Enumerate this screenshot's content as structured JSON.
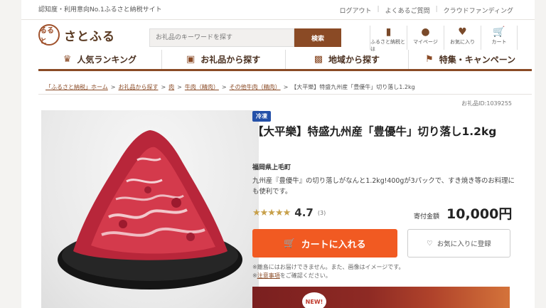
{
  "topbar": {
    "tagline": "認知度・利用意向No.1ふるさと納税サイト",
    "links": [
      "ログアウト",
      "よくあるご質問",
      "クラウドファンディング"
    ]
  },
  "header": {
    "logo_mark": "るると",
    "logo_text": "さとふる",
    "search_placeholder": "お礼品のキーワードを探す",
    "search_button": "検索",
    "icons": [
      {
        "icon": "book-icon",
        "label": "ふるさと納税とは"
      },
      {
        "icon": "person-icon",
        "label": "マイページ"
      },
      {
        "icon": "heart-icon",
        "label": "お気に入り"
      },
      {
        "icon": "cart-icon",
        "label": "カート"
      }
    ]
  },
  "nav": [
    {
      "icon": "crown-icon",
      "label": "人気ランキング"
    },
    {
      "icon": "gift-icon",
      "label": "お礼品から探す"
    },
    {
      "icon": "map-icon",
      "label": "地域から探す"
    },
    {
      "icon": "flag-icon",
      "label": "特集・キャンペーン"
    }
  ],
  "breadcrumb": [
    "「ふるさと納税」ホーム",
    "お礼品から探す",
    "肉",
    "牛肉（精肉）",
    "その他牛肉（精肉）",
    "【大平樂】特盛九州産「豊優牛」切り落し1.2kg"
  ],
  "item_id": "お礼品ID:1039255",
  "product": {
    "badge": "冷凍",
    "title": "【大平樂】特盛九州産「豊優牛」切り落し1.2kg",
    "region": "福岡県上毛町",
    "description": "九州産『豊優牛』の切り落しがなんと1.2kg!400gが3パックで、すき焼き等のお料理にも使利です。",
    "rating": "4.7",
    "rating_count": "(3)",
    "rating_stars": 4.7,
    "price_label": "寄付金額",
    "price": "10,000円",
    "cart_button": "カートに入れる",
    "favorite_button": "お気に入りに登録",
    "note1": "※離島にはお届けできません。また、画像はイメージです。",
    "note2_prefix": "※",
    "note2_link": "注意事項",
    "note2_suffix": "をご確認ください。",
    "banner_badge": "NEW!"
  }
}
